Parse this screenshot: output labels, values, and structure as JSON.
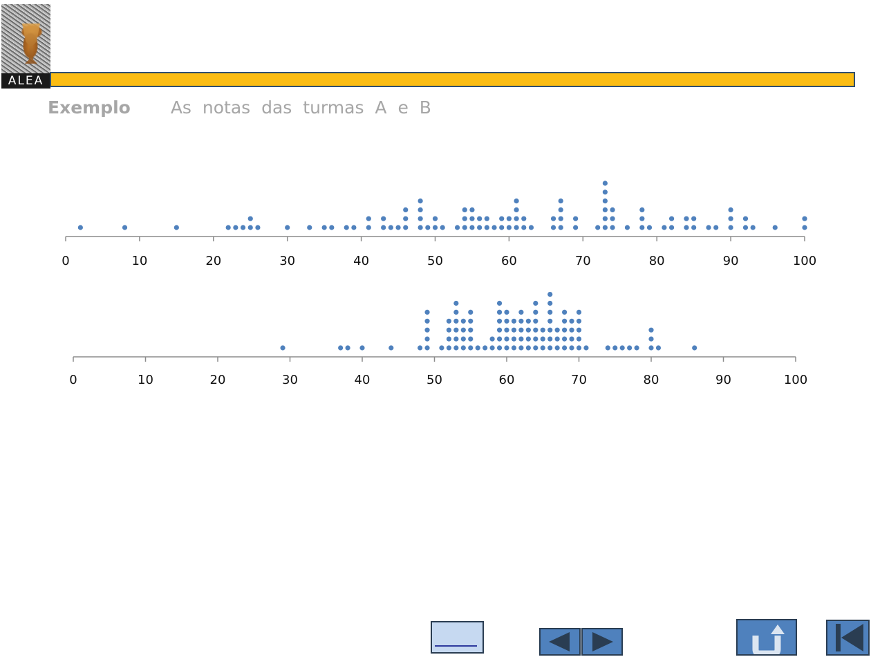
{
  "header": {
    "logo_text": "ALEA",
    "example_label": "Exemplo",
    "subtitle": "As  notas  das  turmas  A  e  B",
    "accent_color": "#fbbd14"
  },
  "nav": {
    "list_icon": "list-icon",
    "prev_icon": "triangle-left-icon",
    "next_icon": "triangle-right-icon",
    "return_icon": "return-arrow-icon",
    "first_icon": "skip-to-start-icon",
    "button_color": "#4f81bd"
  },
  "chart_data": [
    {
      "type": "scatter",
      "subtype": "dot-plot",
      "title": "",
      "xlabel": "",
      "ylabel": "",
      "xlim": [
        0,
        100
      ],
      "xticks": [
        0,
        10,
        20,
        30,
        40,
        50,
        60,
        70,
        80,
        90,
        100
      ],
      "dot_color": "#4f81bd",
      "points": [
        [
          2,
          1
        ],
        [
          8,
          1
        ],
        [
          15,
          1
        ],
        [
          22,
          1
        ],
        [
          23,
          1
        ],
        [
          24,
          1
        ],
        [
          25,
          2
        ],
        [
          26,
          1
        ],
        [
          30,
          1
        ],
        [
          33,
          1
        ],
        [
          35,
          1
        ],
        [
          36,
          1
        ],
        [
          38,
          1
        ],
        [
          39,
          1
        ],
        [
          41,
          2
        ],
        [
          43,
          2
        ],
        [
          44,
          1
        ],
        [
          45,
          1
        ],
        [
          46,
          3
        ],
        [
          48,
          4
        ],
        [
          49,
          1
        ],
        [
          50,
          2
        ],
        [
          51,
          1
        ],
        [
          53,
          1
        ],
        [
          54,
          3
        ],
        [
          55,
          3
        ],
        [
          56,
          2
        ],
        [
          57,
          2
        ],
        [
          58,
          1
        ],
        [
          59,
          2
        ],
        [
          60,
          2
        ],
        [
          61,
          4
        ],
        [
          62,
          2
        ],
        [
          63,
          1
        ],
        [
          66,
          2
        ],
        [
          67,
          4
        ],
        [
          69,
          2
        ],
        [
          72,
          1
        ],
        [
          73,
          6
        ],
        [
          74,
          3
        ],
        [
          76,
          1
        ],
        [
          78,
          3
        ],
        [
          79,
          1
        ],
        [
          81,
          1
        ],
        [
          82,
          2
        ],
        [
          84,
          2
        ],
        [
          85,
          2
        ],
        [
          87,
          1
        ],
        [
          88,
          1
        ],
        [
          90,
          3
        ],
        [
          92,
          2
        ],
        [
          93,
          1
        ],
        [
          96,
          1
        ],
        [
          100,
          2
        ]
      ]
    },
    {
      "type": "scatter",
      "subtype": "dot-plot",
      "title": "",
      "xlabel": "",
      "ylabel": "",
      "xlim": [
        0,
        100
      ],
      "xticks": [
        0,
        10,
        20,
        30,
        40,
        50,
        60,
        70,
        80,
        90,
        100
      ],
      "dot_color": "#4f81bd",
      "points": [
        [
          29,
          1
        ],
        [
          37,
          1
        ],
        [
          38,
          1
        ],
        [
          40,
          1
        ],
        [
          44,
          1
        ],
        [
          48,
          1
        ],
        [
          49,
          5
        ],
        [
          51,
          1
        ],
        [
          52,
          4
        ],
        [
          53,
          6
        ],
        [
          54,
          4
        ],
        [
          55,
          5
        ],
        [
          56,
          1
        ],
        [
          57,
          1
        ],
        [
          58,
          2
        ],
        [
          59,
          6
        ],
        [
          60,
          5
        ],
        [
          61,
          4
        ],
        [
          62,
          5
        ],
        [
          63,
          4
        ],
        [
          64,
          6
        ],
        [
          65,
          3
        ],
        [
          66,
          7
        ],
        [
          67,
          3
        ],
        [
          68,
          5
        ],
        [
          69,
          4
        ],
        [
          70,
          5
        ],
        [
          71,
          1
        ],
        [
          74,
          1
        ],
        [
          75,
          1
        ],
        [
          76,
          1
        ],
        [
          77,
          1
        ],
        [
          78,
          1
        ],
        [
          80,
          3
        ],
        [
          81,
          1
        ],
        [
          86,
          1
        ]
      ]
    }
  ]
}
